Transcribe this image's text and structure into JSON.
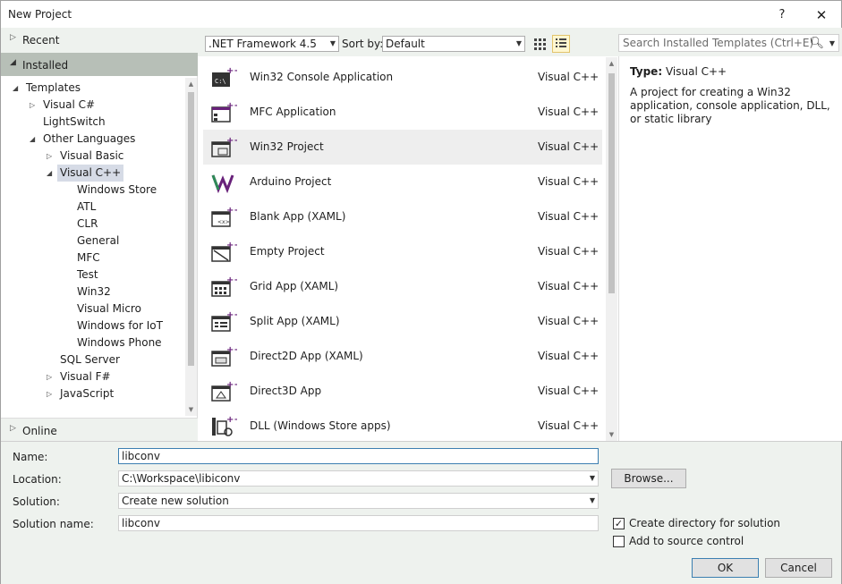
{
  "window": {
    "title": "New Project",
    "help_glyph": "?",
    "close_glyph": "✕"
  },
  "left": {
    "recent": "Recent",
    "installed": "Installed",
    "online": "Online",
    "tree": [
      {
        "label": "Templates",
        "indent": 0,
        "arrow": "◢",
        "selected": false
      },
      {
        "label": "Visual C#",
        "indent": 1,
        "arrow": "▷",
        "selected": false
      },
      {
        "label": "LightSwitch",
        "indent": 1,
        "arrow": "",
        "selected": false
      },
      {
        "label": "Other Languages",
        "indent": 1,
        "arrow": "◢",
        "selected": false
      },
      {
        "label": "Visual Basic",
        "indent": 2,
        "arrow": "▷",
        "selected": false
      },
      {
        "label": "Visual C++",
        "indent": 2,
        "arrow": "◢",
        "selected": true
      },
      {
        "label": "Windows Store",
        "indent": 3,
        "arrow": "",
        "selected": false
      },
      {
        "label": "ATL",
        "indent": 3,
        "arrow": "",
        "selected": false
      },
      {
        "label": "CLR",
        "indent": 3,
        "arrow": "",
        "selected": false
      },
      {
        "label": "General",
        "indent": 3,
        "arrow": "",
        "selected": false
      },
      {
        "label": "MFC",
        "indent": 3,
        "arrow": "",
        "selected": false
      },
      {
        "label": "Test",
        "indent": 3,
        "arrow": "",
        "selected": false
      },
      {
        "label": "Win32",
        "indent": 3,
        "arrow": "",
        "selected": false
      },
      {
        "label": "Visual Micro",
        "indent": 3,
        "arrow": "",
        "selected": false
      },
      {
        "label": "Windows for IoT",
        "indent": 3,
        "arrow": "",
        "selected": false
      },
      {
        "label": "Windows Phone",
        "indent": 3,
        "arrow": "",
        "selected": false
      },
      {
        "label": "SQL Server",
        "indent": 2,
        "arrow": "",
        "selected": false
      },
      {
        "label": "Visual F#",
        "indent": 2,
        "arrow": "▷",
        "selected": false
      },
      {
        "label": "JavaScript",
        "indent": 2,
        "arrow": "▷",
        "selected": false
      }
    ]
  },
  "toolbar": {
    "framework": ".NET Framework 4.5",
    "sort_by_label": "Sort by:",
    "sort_value": "Default",
    "search_placeholder": "Search Installed Templates (Ctrl+E)"
  },
  "templates": [
    {
      "name": "Win32 Console Application",
      "lang": "Visual C++",
      "icon": "console-app-icon",
      "selected": false
    },
    {
      "name": "MFC Application",
      "lang": "Visual C++",
      "icon": "mfc-app-icon",
      "selected": false
    },
    {
      "name": "Win32 Project",
      "lang": "Visual C++",
      "icon": "win32-project-icon",
      "selected": true
    },
    {
      "name": "Arduino Project",
      "lang": "Visual C++",
      "icon": "arduino-icon",
      "selected": false
    },
    {
      "name": "Blank App (XAML)",
      "lang": "Visual C++",
      "icon": "blank-app-icon",
      "selected": false
    },
    {
      "name": "Empty Project",
      "lang": "Visual C++",
      "icon": "empty-project-icon",
      "selected": false
    },
    {
      "name": "Grid App (XAML)",
      "lang": "Visual C++",
      "icon": "grid-app-icon",
      "selected": false
    },
    {
      "name": "Split App (XAML)",
      "lang": "Visual C++",
      "icon": "split-app-icon",
      "selected": false
    },
    {
      "name": "Direct2D App (XAML)",
      "lang": "Visual C++",
      "icon": "direct2d-app-icon",
      "selected": false
    },
    {
      "name": "Direct3D App",
      "lang": "Visual C++",
      "icon": "direct3d-app-icon",
      "selected": false
    },
    {
      "name": "DLL (Windows Store apps)",
      "lang": "Visual C++",
      "icon": "dll-icon",
      "selected": false
    }
  ],
  "details": {
    "type_label": "Type:",
    "type_value": "Visual C++",
    "description": "A project for creating a Win32 application, console application, DLL, or static library"
  },
  "form": {
    "name_label": "Name:",
    "name_value": "libconv",
    "location_label": "Location:",
    "location_value": "C:\\Workspace\\libiconv",
    "solution_label": "Solution:",
    "solution_value": "Create new solution",
    "solution_name_label": "Solution name:",
    "solution_name_value": "libconv",
    "browse_label": "Browse...",
    "create_dir_label": "Create directory for solution",
    "create_dir_checked": true,
    "source_control_label": "Add to source control",
    "source_control_checked": false,
    "ok_label": "OK",
    "cancel_label": "Cancel"
  },
  "colors": {
    "accent": "#68217a",
    "selection": "#d6dbe6",
    "panel": "#eef2ee"
  }
}
